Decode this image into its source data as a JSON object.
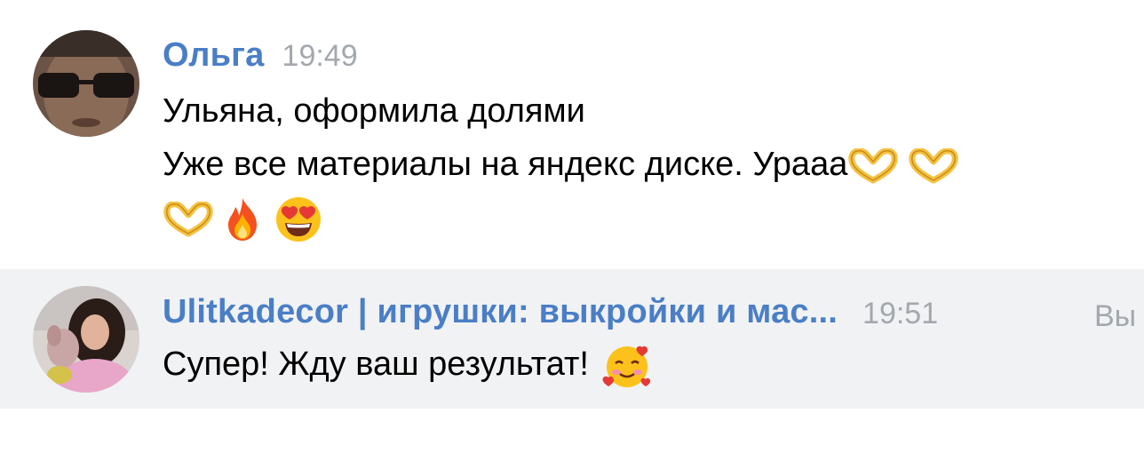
{
  "messages": [
    {
      "author": "Ольга",
      "time": "19:49",
      "lines": [
        "Ульяна, оформила долями",
        "Уже все материалы на яндекс диске. Урааа"
      ],
      "emoji_line_1": [
        "heart-hands",
        "heart-hands"
      ],
      "emoji_line_2": [
        "heart-hands",
        "fire",
        "heart-eyes"
      ]
    },
    {
      "author": "Ulitkadecor | игрушки: выкройки и мас...",
      "time": "19:51",
      "suffix": "Вы",
      "lines": [
        "Супер! Жду ваш результат!"
      ],
      "emoji_line_1": [
        "smiling-face-with-hearts"
      ]
    }
  ],
  "colors": {
    "author": "#4a7ec6",
    "time": "#a3a8ae",
    "highlight_bg": "#f1f2f4",
    "text": "#000000"
  }
}
